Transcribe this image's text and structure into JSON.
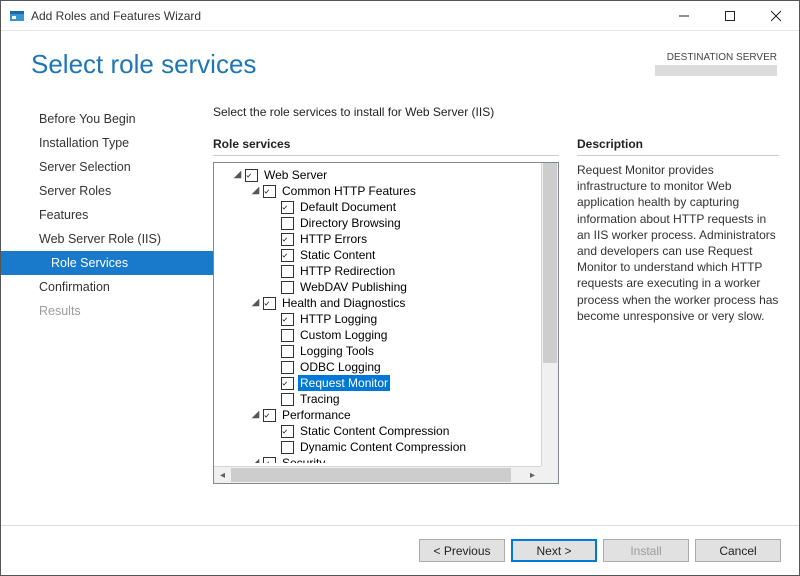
{
  "window": {
    "title": "Add Roles and Features Wizard"
  },
  "header": {
    "pageTitle": "Select role services",
    "destLabel": "DESTINATION SERVER"
  },
  "sidebar": {
    "steps": [
      {
        "label": "Before You Begin",
        "state": "normal"
      },
      {
        "label": "Installation Type",
        "state": "normal"
      },
      {
        "label": "Server Selection",
        "state": "normal"
      },
      {
        "label": "Server Roles",
        "state": "normal"
      },
      {
        "label": "Features",
        "state": "normal"
      },
      {
        "label": "Web Server Role (IIS)",
        "state": "normal"
      },
      {
        "label": "Role Services",
        "state": "selected",
        "sub": true
      },
      {
        "label": "Confirmation",
        "state": "normal"
      },
      {
        "label": "Results",
        "state": "disabled"
      }
    ]
  },
  "content": {
    "intro": "Select the role services to install for Web Server (IIS)",
    "roleServicesHead": "Role services",
    "descriptionHead": "Description",
    "description": "Request Monitor provides infrastructure to monitor Web application health by capturing information about HTTP requests in an IIS worker process. Administrators and developers can use Request Monitor to understand which HTTP requests are executing in a worker process when the worker process has become unresponsive or very slow."
  },
  "tree": [
    {
      "depth": 1,
      "expander": "open",
      "checked": true,
      "label": "Web Server"
    },
    {
      "depth": 2,
      "expander": "open",
      "checked": true,
      "label": "Common HTTP Features"
    },
    {
      "depth": 3,
      "expander": "none",
      "checked": true,
      "label": "Default Document"
    },
    {
      "depth": 3,
      "expander": "none",
      "checked": false,
      "label": "Directory Browsing"
    },
    {
      "depth": 3,
      "expander": "none",
      "checked": true,
      "label": "HTTP Errors"
    },
    {
      "depth": 3,
      "expander": "none",
      "checked": true,
      "label": "Static Content"
    },
    {
      "depth": 3,
      "expander": "none",
      "checked": false,
      "label": "HTTP Redirection"
    },
    {
      "depth": 3,
      "expander": "none",
      "checked": false,
      "label": "WebDAV Publishing"
    },
    {
      "depth": 2,
      "expander": "open",
      "checked": true,
      "label": "Health and Diagnostics"
    },
    {
      "depth": 3,
      "expander": "none",
      "checked": true,
      "label": "HTTP Logging"
    },
    {
      "depth": 3,
      "expander": "none",
      "checked": false,
      "label": "Custom Logging"
    },
    {
      "depth": 3,
      "expander": "none",
      "checked": false,
      "label": "Logging Tools"
    },
    {
      "depth": 3,
      "expander": "none",
      "checked": false,
      "label": "ODBC Logging"
    },
    {
      "depth": 3,
      "expander": "none",
      "checked": true,
      "label": "Request Monitor",
      "selected": true
    },
    {
      "depth": 3,
      "expander": "none",
      "checked": false,
      "label": "Tracing"
    },
    {
      "depth": 2,
      "expander": "open",
      "checked": true,
      "label": "Performance"
    },
    {
      "depth": 3,
      "expander": "none",
      "checked": true,
      "label": "Static Content Compression"
    },
    {
      "depth": 3,
      "expander": "none",
      "checked": false,
      "label": "Dynamic Content Compression"
    },
    {
      "depth": 2,
      "expander": "open",
      "checked": true,
      "label": "Security"
    }
  ],
  "buttons": {
    "previous": "< Previous",
    "next": "Next >",
    "install": "Install",
    "cancel": "Cancel"
  }
}
